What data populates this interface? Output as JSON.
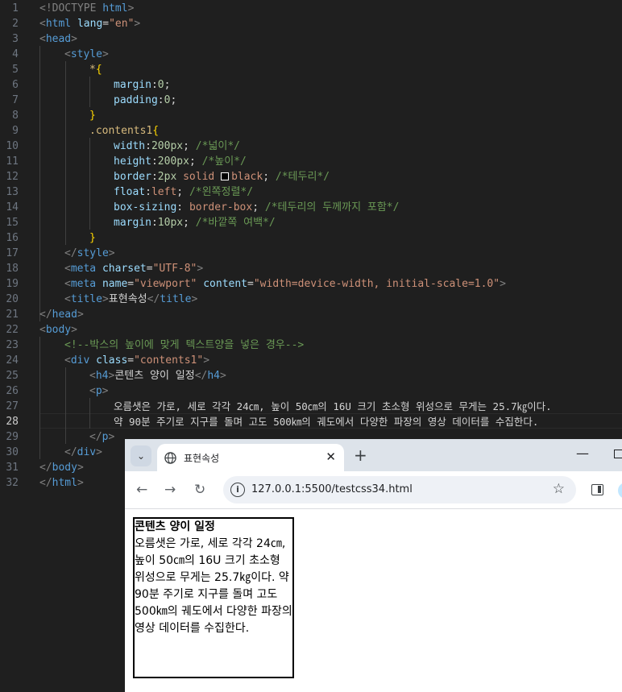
{
  "editor": {
    "line_numbers": [
      "1",
      "2",
      "3",
      "4",
      "5",
      "6",
      "7",
      "8",
      "9",
      "10",
      "11",
      "12",
      "13",
      "14",
      "15",
      "16",
      "17",
      "18",
      "19",
      "20",
      "21",
      "22",
      "23",
      "24",
      "25",
      "26",
      "27",
      "28",
      "29",
      "30",
      "31",
      "32"
    ],
    "active_line": "28",
    "tokens": {
      "l1_a": "<!DOCTYPE ",
      "l1_b": "html",
      "l1_c": ">",
      "l2_a": "<",
      "l2_b": "html",
      "l2_c": " lang",
      "l2_d": "=",
      "l2_e": "\"en\"",
      "l2_f": ">",
      "l3_a": "<",
      "l3_b": "head",
      "l3_c": ">",
      "l4_a": "<",
      "l4_b": "style",
      "l4_c": ">",
      "l5_a": "*",
      "l5_b": "{",
      "l6_a": "margin",
      "l6_b": ":",
      "l6_c": "0",
      "l6_d": ";",
      "l7_a": "padding",
      "l7_b": ":",
      "l7_c": "0",
      "l7_d": ";",
      "l8_a": "}",
      "l9_a": ".contents1",
      "l9_b": "{",
      "l10_a": "width",
      "l10_b": ":",
      "l10_c": "200px",
      "l10_d": "; ",
      "l10_e": "/*넓이*/",
      "l11_a": "height",
      "l11_b": ":",
      "l11_c": "200px",
      "l11_d": "; ",
      "l11_e": "/*높이*/",
      "l12_a": "border",
      "l12_b": ":",
      "l12_c": "2px",
      "l12_d": " solid ",
      "l12_e": "black",
      "l12_f": "; ",
      "l12_g": "/*테두리*/",
      "l13_a": "float",
      "l13_b": ":",
      "l13_c": "left",
      "l13_d": "; ",
      "l13_e": "/*왼쪽정렬*/",
      "l14_a": "box-sizing",
      "l14_b": ": ",
      "l14_c": "border-box",
      "l14_d": "; ",
      "l14_e": "/*테두리의 두께까지 포함*/",
      "l15_a": "margin",
      "l15_b": ":",
      "l15_c": "10px",
      "l15_d": "; ",
      "l15_e": "/*바깥쪽 여백*/",
      "l16_a": "}",
      "l17_a": "</",
      "l17_b": "style",
      "l17_c": ">",
      "l18_a": "<",
      "l18_b": "meta",
      "l18_c": " charset",
      "l18_d": "=",
      "l18_e": "\"UTF-8\"",
      "l18_f": ">",
      "l19_a": "<",
      "l19_b": "meta",
      "l19_c": " name",
      "l19_d": "=",
      "l19_e": "\"viewport\"",
      "l19_f": " content",
      "l19_g": "=",
      "l19_h": "\"width=device-width, initial-scale=1.0\"",
      "l19_i": ">",
      "l20_a": "<",
      "l20_b": "title",
      "l20_c": ">",
      "l20_d": "표현속성",
      "l20_e": "</",
      "l20_f": "title",
      "l20_g": ">",
      "l21_a": "</",
      "l21_b": "head",
      "l21_c": ">",
      "l22_a": "<",
      "l22_b": "body",
      "l22_c": ">",
      "l23_a": "<!--박스의 높이에 맞게 텍스트양을 넣은 경우-->",
      "l24_a": "<",
      "l24_b": "div",
      "l24_c": " class",
      "l24_d": "=",
      "l24_e": "\"contents1\"",
      "l24_f": ">",
      "l25_a": "<",
      "l25_b": "h4",
      "l25_c": ">",
      "l25_d": "콘텐츠 양이 일정",
      "l25_e": "</",
      "l25_f": "h4",
      "l25_g": ">",
      "l26_a": "<",
      "l26_b": "p",
      "l26_c": ">",
      "l27_a": "오름샛은 가로, 세로 각각 24㎝, 높이 50㎝의 16U 크기 초소형 위성으로 무게는 25.7㎏이다.",
      "l28_a": "약 90분 주기로 지구를 돌며 고도 500㎞의 궤도에서 다양한 파장의 영상 데이터를 수집한다.",
      "l29_a": "</",
      "l29_b": "p",
      "l29_c": ">",
      "l30_a": "</",
      "l30_b": "div",
      "l30_c": ">",
      "l31_a": "</",
      "l31_b": "body",
      "l31_c": ">",
      "l32_a": "</",
      "l32_b": "html",
      "l32_c": ">"
    }
  },
  "browser": {
    "tab_title": "표현속성",
    "tab_close": "✕",
    "new_tab": "+",
    "minimize": "—",
    "url": "127.0.0.1:5500/testcss34.html",
    "back": "←",
    "forward": "→",
    "reload": "↻",
    "bookmark": "☆",
    "site_info": "i",
    "tab_search": "⌄"
  },
  "page": {
    "heading": "콘텐츠 양이 일정",
    "paragraph": "오름샛은 가로, 세로 각각 24㎝, 높이 50㎝의 16U 크기 초소형 위성으로 무게는 25.7㎏이다. 약 90분 주기로 지구를 돌며 고도 500㎞의 궤도에서 다양한 파장의 영상 데이터를 수집한다."
  },
  "colors": {
    "editor_bg": "#1f1f1f",
    "tag_name": "#569cd6",
    "attribute": "#9cdcfe",
    "string": "#ce9178",
    "comment": "#6a9955",
    "selector": "#d7ba7d",
    "number": "#b5cea8",
    "tab_strip": "#dde3ea"
  }
}
